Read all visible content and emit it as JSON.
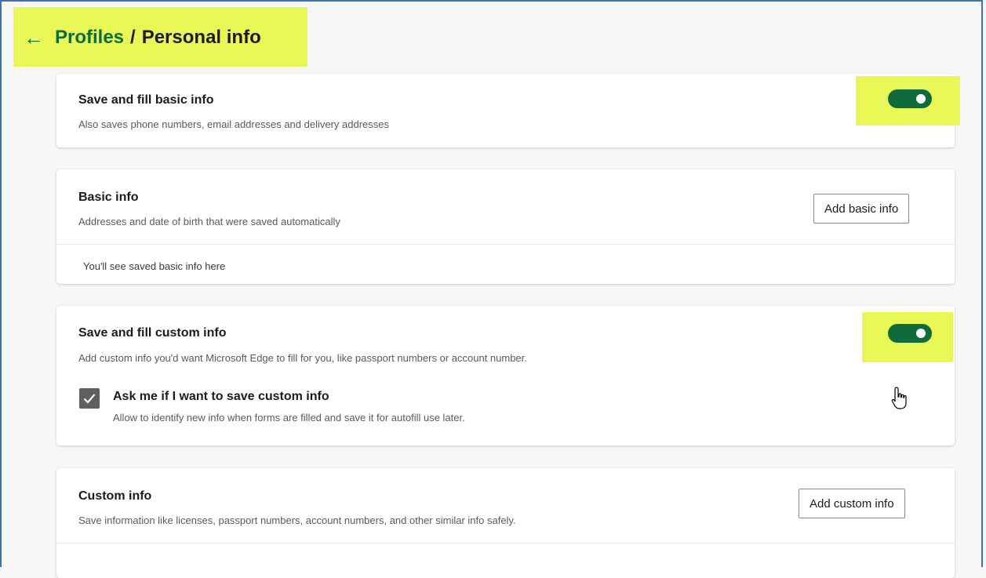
{
  "header": {
    "back_icon": "arrow-left-icon",
    "breadcrumb_link": "Profiles",
    "separator": "/",
    "current": "Personal info"
  },
  "cards": {
    "save_basic": {
      "title": "Save and fill basic info",
      "description": "Also saves phone numbers, email addresses and delivery addresses",
      "toggle_on": true
    },
    "basic_info": {
      "title": "Basic info",
      "description": "Addresses and date of birth that were saved automatically",
      "button": "Add basic info",
      "empty_text": "You'll see saved basic info here"
    },
    "save_custom": {
      "title": "Save and fill custom info",
      "description": "Add custom info you'd want Microsoft Edge to fill for you, like passport numbers or account number.",
      "toggle_on": true,
      "checkbox_label": "Ask me if I want to save custom info",
      "checkbox_desc": "Allow to identify new info when forms are filled and save it for autofill use later.",
      "checkbox_checked": true
    },
    "custom_info": {
      "title": "Custom info",
      "description": "Save information like licenses, passport numbers, account numbers, and other similar info safely.",
      "button": "Add custom info"
    }
  },
  "colors": {
    "accent": "#0f6a3c",
    "highlight": "#e8f754",
    "frame": "#3b6fc2"
  },
  "cursor_icon": "hand-pointer-icon"
}
